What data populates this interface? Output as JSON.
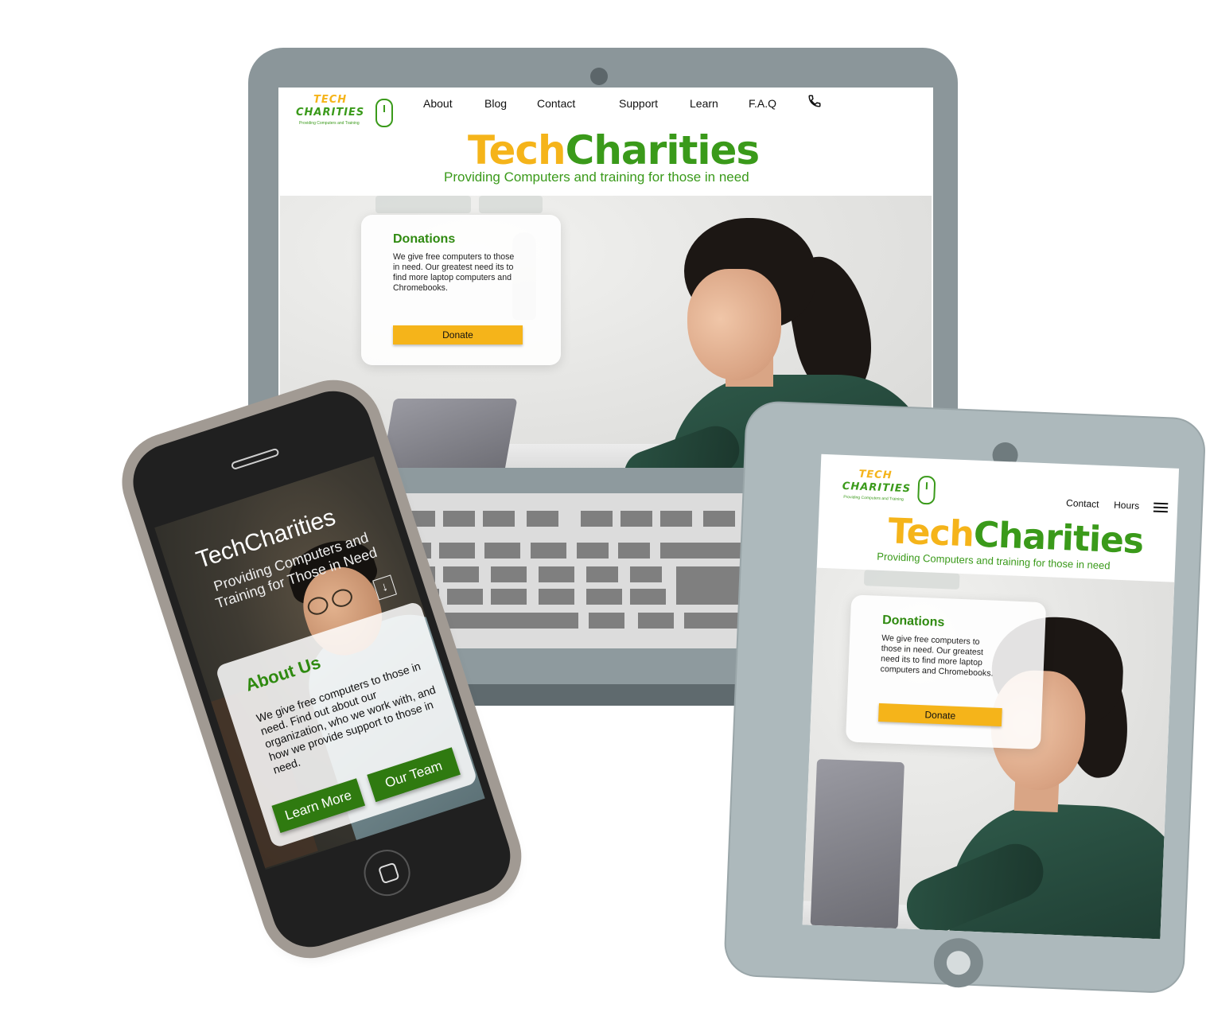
{
  "brand": {
    "name_part1": "Tech",
    "name_part2": "Charities",
    "logo_line1": "TECH",
    "logo_line2": "CHARITIES",
    "logo_tagline": "Providing Computers and Training",
    "tagline": "Providing Computers and training for those in need"
  },
  "desktop": {
    "nav": [
      "About",
      "Blog",
      "Contact",
      "Support",
      "Learn",
      "F.A.Q"
    ],
    "nav_icon": "phone-icon"
  },
  "tablet": {
    "nav": [
      "Contact",
      "Hours"
    ],
    "menu_icon": "hamburger-menu-icon"
  },
  "donations": {
    "title": "Donations",
    "body": "We give free computers to those in need. Our greatest need its to find more laptop computers and Chromebooks.",
    "button": "Donate"
  },
  "mobile": {
    "title": "TechCharities",
    "subtitle": "Providing Computers and Training for Those in Need",
    "scroll_icon": "down-arrow-icon",
    "about_title": "About Us",
    "about_body": "We give free computers to those in need. Find out about our organization, who we work with, and how we provide support to those in need.",
    "btn_learn": "Learn More",
    "btn_team": "Our Team"
  },
  "colors": {
    "brand_yellow": "#f5b41a",
    "brand_green": "#3a9a1a",
    "button_green": "#2f7a10",
    "device_gray": "#8b969a"
  }
}
